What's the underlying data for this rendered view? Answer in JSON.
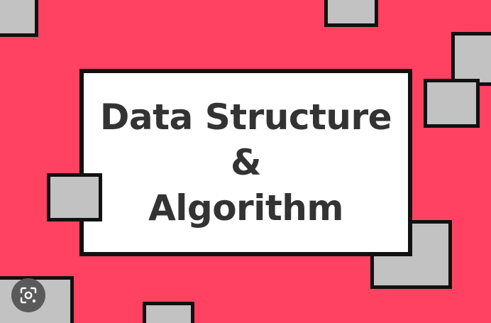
{
  "card": {
    "line1": "Data Structure",
    "line2": "&",
    "line3": "Algorithm"
  },
  "colors": {
    "background": "#FF4262",
    "square_fill": "#C2C2C2",
    "outline": "#111111",
    "card_fill": "#FFFFFF",
    "text": "#333333"
  },
  "icons": {
    "lens_button": "image-search-lens-icon"
  }
}
